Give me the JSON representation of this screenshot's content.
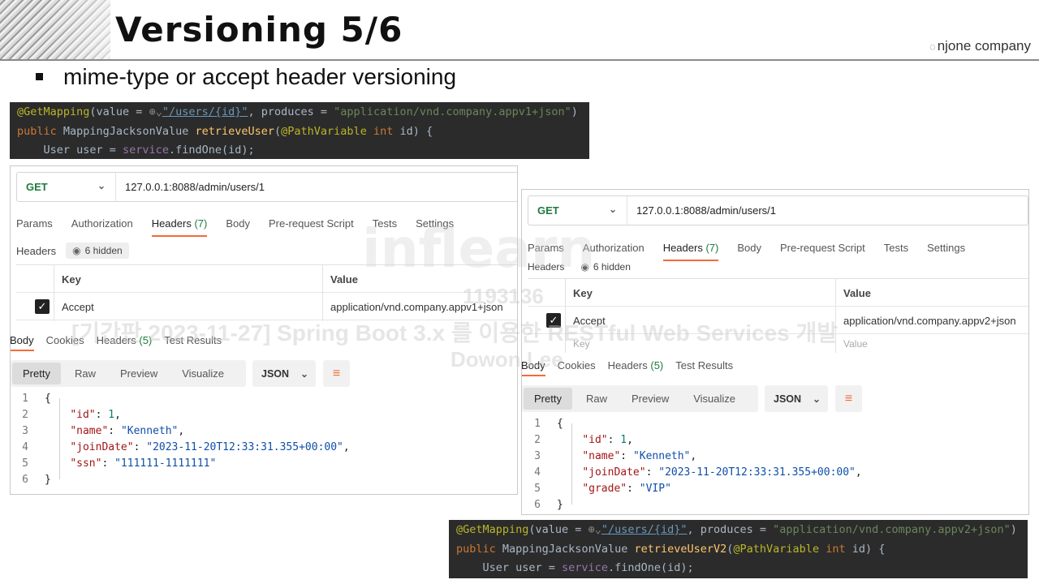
{
  "slide": {
    "title": "Versioning 5/6",
    "brand": "njone company",
    "bullet": "mime-type or accept header versioning"
  },
  "code_top": {
    "l1_annotation": "@GetMapping",
    "l1_a": "(value = ",
    "l1_path": "\"/users/{id}\"",
    "l1_b": ", produces = ",
    "l1_produces": "\"application/vnd.company.appv1+json\"",
    "l1_c": ")",
    "l2_kw": "public ",
    "l2_type": "MappingJacksonValue ",
    "l2_fn": "retrieveUser",
    "l2_a": "(",
    "l2_ann": "@PathVariable ",
    "l2_int": "int ",
    "l2_b": "id) {",
    "l3_a": "    User user = ",
    "l3_fld": "service",
    "l3_b": ".findOne(id);"
  },
  "code_bottom": {
    "l1_annotation": "@GetMapping",
    "l1_a": "(value = ",
    "l1_path": "\"/users/{id}\"",
    "l1_b": ", produces = ",
    "l1_produces": "\"application/vnd.company.appv2+json\"",
    "l1_c": ")",
    "l2_kw": "public ",
    "l2_type": "MappingJacksonValue ",
    "l2_fn": "retrieveUserV2",
    "l2_a": "(",
    "l2_ann": "@PathVariable ",
    "l2_int": "int ",
    "l2_b": "id) {",
    "l3_a": "    User user = ",
    "l3_fld": "service",
    "l3_b": ".findOne(id);"
  },
  "left": {
    "method": "GET",
    "url": "127.0.0.1:8088/admin/users/1",
    "tabs": [
      "Params",
      "Authorization",
      "Headers",
      "Body",
      "Pre-request Script",
      "Tests",
      "Settings"
    ],
    "headers_count": "(7)",
    "headers_label": "Headers",
    "hidden": "6 hidden",
    "col_key": "Key",
    "col_value": "Value",
    "row_key": "Accept",
    "row_value": "application/vnd.company.appv1+json",
    "resp_tabs": [
      "Body",
      "Cookies",
      "Headers",
      "Test Results"
    ],
    "resp_headers_count": "(5)",
    "views": [
      "Pretty",
      "Raw",
      "Preview",
      "Visualize"
    ],
    "format": "JSON",
    "json_lines": [
      {
        "n": "1",
        "t": "{"
      },
      {
        "n": "2",
        "k": "\"id\"",
        "v": "1",
        "vt": "num",
        "comma": ","
      },
      {
        "n": "3",
        "k": "\"name\"",
        "v": "\"Kenneth\"",
        "vt": "str",
        "comma": ","
      },
      {
        "n": "4",
        "k": "\"joinDate\"",
        "v": "\"2023-11-20T12:33:31.355+00:00\"",
        "vt": "str",
        "comma": ","
      },
      {
        "n": "5",
        "k": "\"ssn\"",
        "v": "\"111111-1111111\"",
        "vt": "str",
        "comma": ""
      },
      {
        "n": "6",
        "t": "}"
      }
    ]
  },
  "right": {
    "method": "GET",
    "url": "127.0.0.1:8088/admin/users/1",
    "tabs": [
      "Params",
      "Authorization",
      "Headers",
      "Body",
      "Pre-request Script",
      "Tests",
      "Settings"
    ],
    "headers_count": "(7)",
    "headers_label": "Headers",
    "hidden": "6 hidden",
    "col_key": "Key",
    "col_value": "Value",
    "row_key": "Accept",
    "row_value": "application/vnd.company.appv2+json",
    "placeholder_key": "Key",
    "placeholder_value": "Value",
    "resp_tabs": [
      "Body",
      "Cookies",
      "Headers",
      "Test Results"
    ],
    "resp_headers_count": "(5)",
    "views": [
      "Pretty",
      "Raw",
      "Preview",
      "Visualize"
    ],
    "format": "JSON",
    "json_lines": [
      {
        "n": "1",
        "t": "{"
      },
      {
        "n": "2",
        "k": "\"id\"",
        "v": "1",
        "vt": "num",
        "comma": ","
      },
      {
        "n": "3",
        "k": "\"name\"",
        "v": "\"Kenneth\"",
        "vt": "str",
        "comma": ","
      },
      {
        "n": "4",
        "k": "\"joinDate\"",
        "v": "\"2023-11-20T12:33:31.355+00:00\"",
        "vt": "str",
        "comma": ","
      },
      {
        "n": "5",
        "k": "\"grade\"",
        "v": "\"VIP\"",
        "vt": "str",
        "comma": ""
      },
      {
        "n": "6",
        "t": "}"
      }
    ]
  },
  "watermark": {
    "logo": "inflearn",
    "id": "1193136",
    "line": "[기간판 2023-11-27] Spring Boot 3.x 를 이용한 RESTful Web Services 개발",
    "author": "Dowon Lee"
  },
  "colors": {
    "accent": "#f26b3a",
    "get_method": "#1f7a3e",
    "code_bg": "#2b2b2b"
  }
}
